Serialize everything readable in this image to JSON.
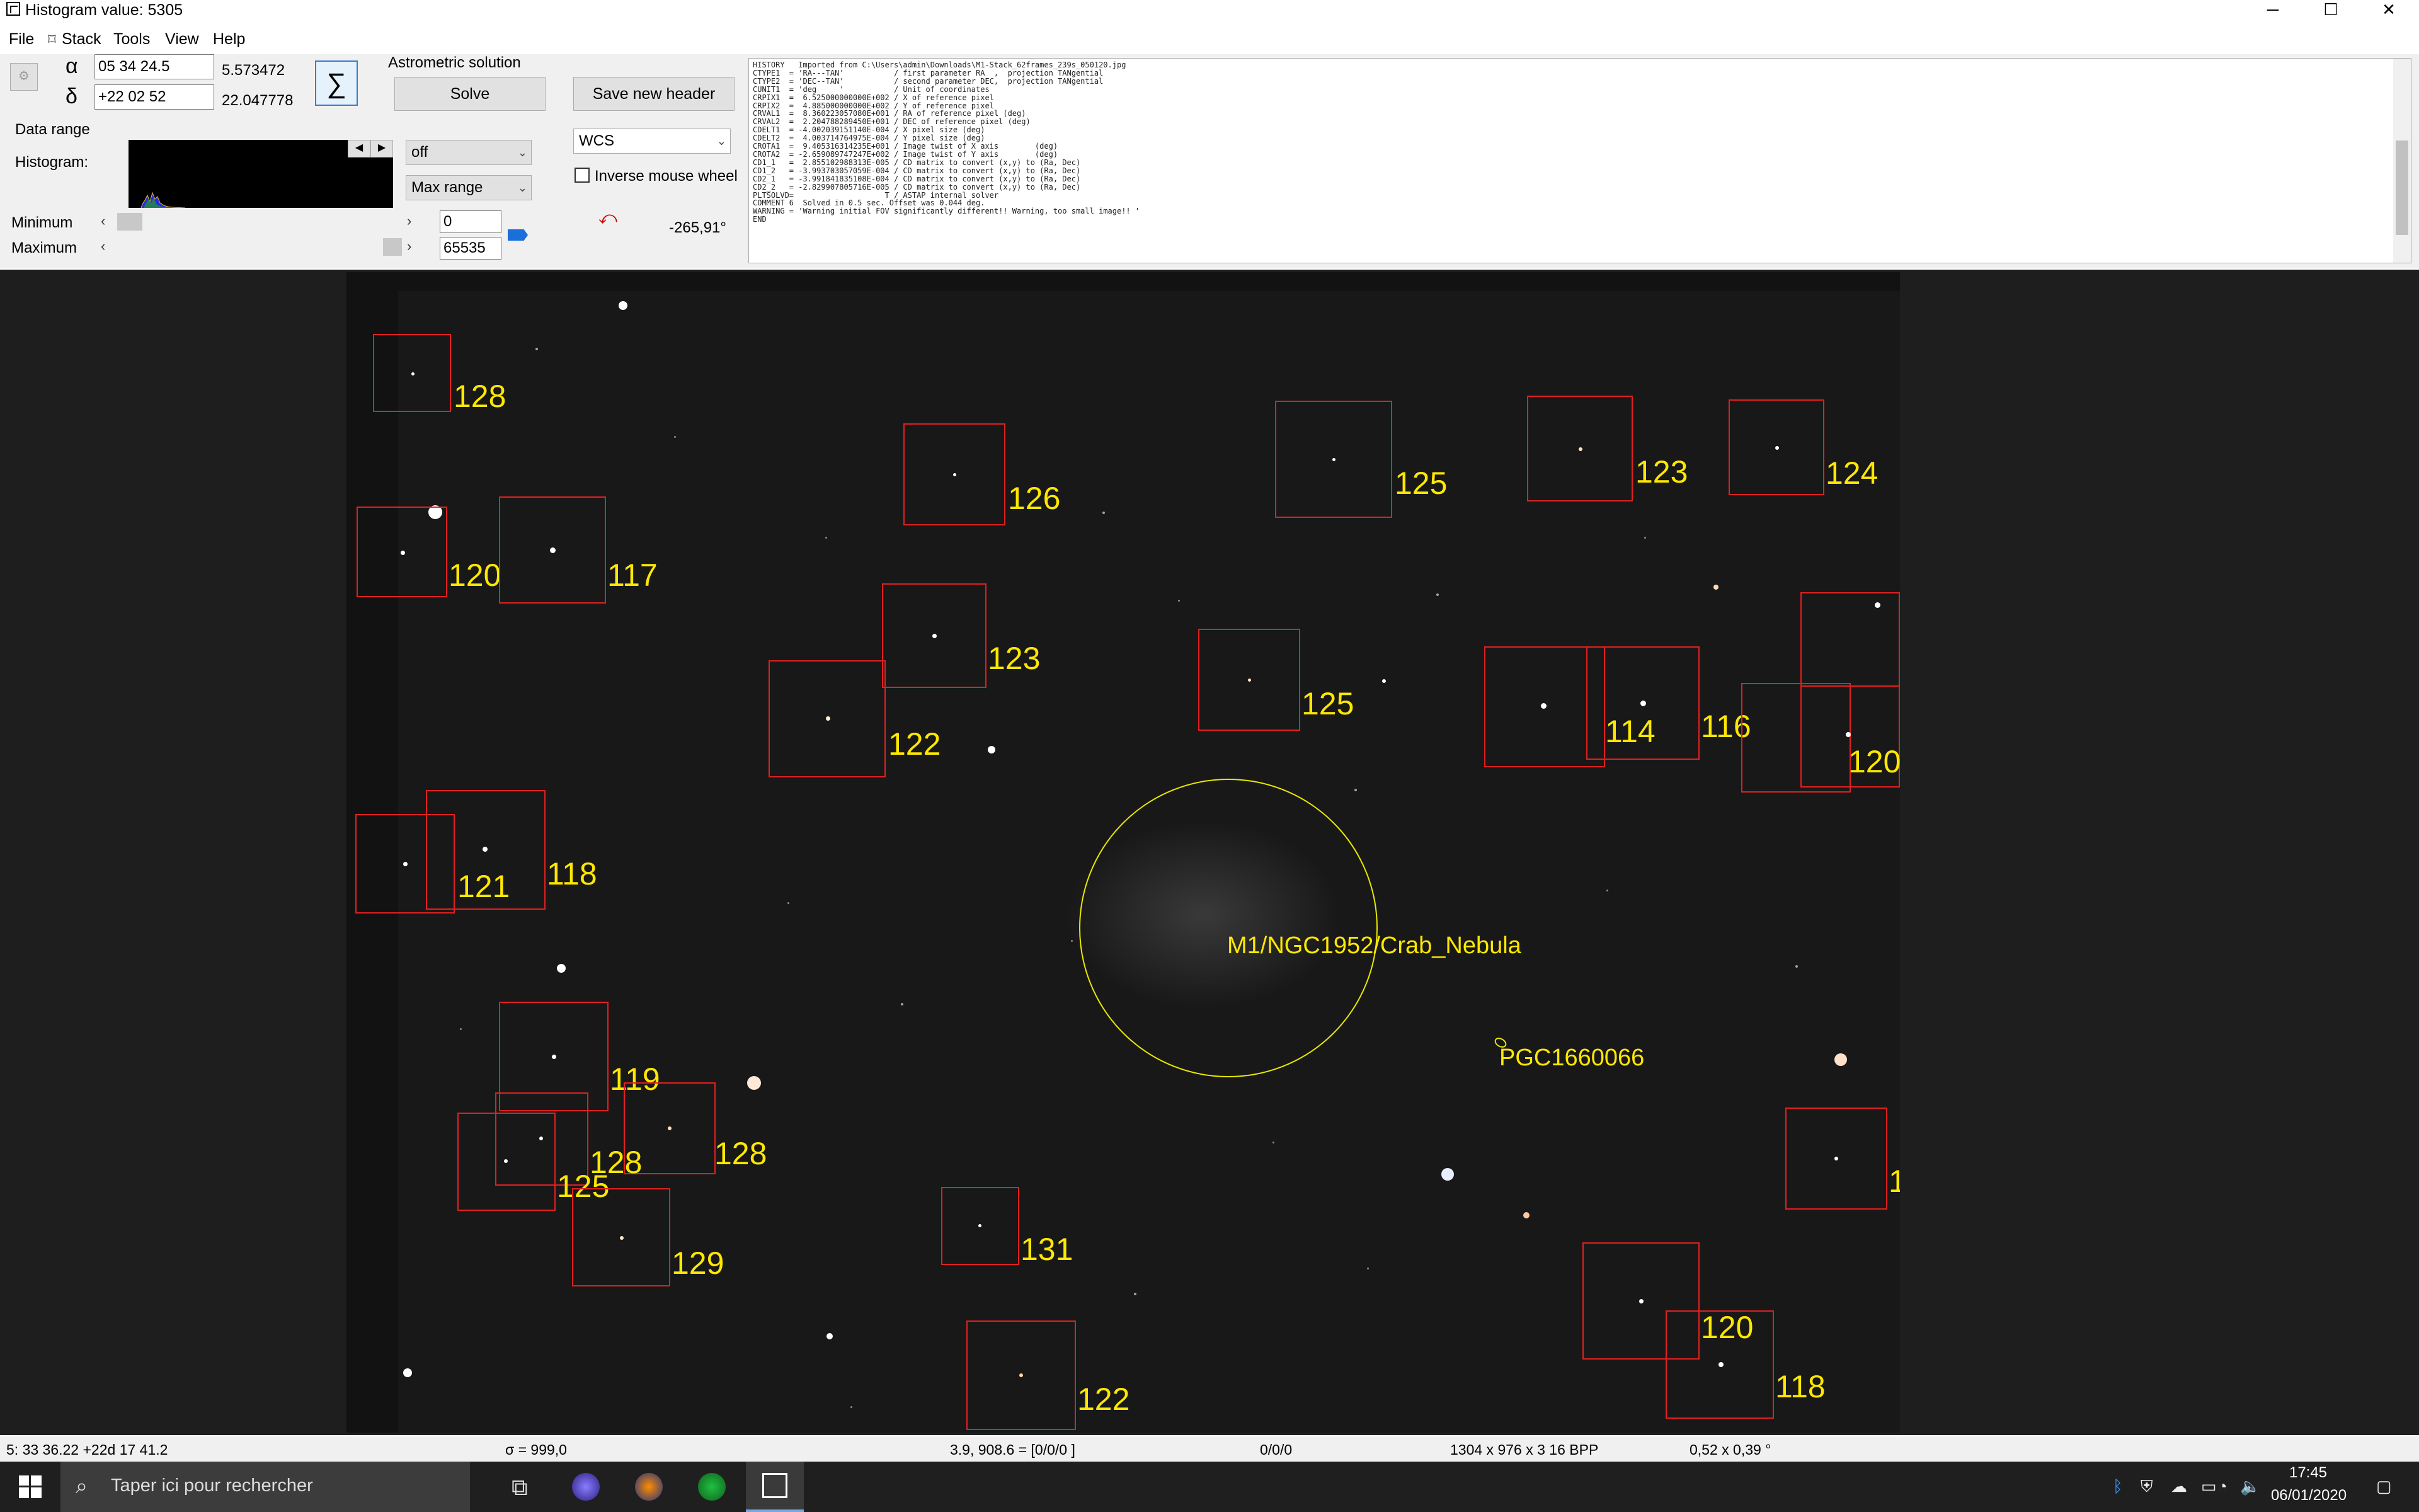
{
  "window": {
    "title": "Histogram value: 5305",
    "minimize": "─",
    "maximize": "☐",
    "close": "✕"
  },
  "menu": [
    "File",
    "Stack",
    "Tools",
    "View",
    "Help"
  ],
  "coords": {
    "alpha_symbol": "α",
    "delta_symbol": "δ",
    "ra_value": "05 34 24.5",
    "ra_decimal": "5.573472",
    "dec_value": "+22 02 52",
    "dec_decimal": "22.047778",
    "sigma_symbol": "∑"
  },
  "astrometric": {
    "label": "Astrometric solution",
    "solve_button": "Solve",
    "save_header_button": "Save new header",
    "wcs_selected": "WCS"
  },
  "data_range": {
    "label": "Data range",
    "histogram_label": "Histogram:",
    "mode_selected": "off",
    "range_selected": "Max range",
    "minimum_label": "Minimum",
    "maximum_label": "Maximum",
    "minimum_value": "0",
    "maximum_value": "65535",
    "inverse_mouse_wheel_label": "Inverse mouse wheel",
    "inverse_mouse_wheel_checked": false,
    "rotation_readout": "-265,91°"
  },
  "fits_header": "HISTORY   Imported from C:\\Users\\admin\\Downloads\\M1-Stack_62frames_239s_050120.jpg\nCTYPE1  = 'RA---TAN'           / first parameter RA  ,  projection TANgential\nCTYPE2  = 'DEC--TAN'           / second parameter DEC,  projection TANgential\nCUNIT1  = 'deg     '           / Unit of coordinates\nCRPIX1  =  6.525000000000E+002 / X of reference pixel\nCRPIX2  =  4.885000000000E+002 / Y of reference pixel\nCRVAL1  =  8.360223057080E+001 / RA of reference pixel (deg)\nCRVAL2  =  2.204788289450E+001 / DEC of reference pixel (deg)\nCDELT1  = -4.002039151140E-004 / X pixel size (deg)\nCDELT2  =  4.003714764975E-004 / Y pixel size (deg)\nCROTA1  =  9.405316314235E+001 / Image twist of X axis        (deg)\nCROTA2  = -2.659089747247E+002 / Image twist of Y axis        (deg)\nCD1_1   =  2.855102988313E-005 / CD matrix to convert (x,y) to (Ra, Dec)\nCD1_2   = -3.993703057059E-004 / CD matrix to convert (x,y) to (Ra, Dec)\nCD2_1   = -3.991841835108E-004 / CD matrix to convert (x,y) to (Ra, Dec)\nCD2_2   = -2.829907805716E-005 / CD matrix to convert (x,y) to (Ra, Dec)\nPLTSOLVD=                    T / ASTAP internal solver\nCOMMENT 6  Solved in 0.5 sec. Offset was 0.044 deg.\nWARNING = 'Warning initial FOV significantly different!! Warning, too small image!! '\nEND",
  "annotations": {
    "nebula": "M1/NGC1952/Crab_Nebula",
    "galaxy": "PGC1660066"
  },
  "star_labels": [
    {
      "hfd": "128"
    },
    {
      "hfd": "126"
    },
    {
      "hfd": "125"
    },
    {
      "hfd": "123"
    },
    {
      "hfd": "124"
    },
    {
      "hfd": "120"
    },
    {
      "hfd": "117"
    },
    {
      "hfd": "123"
    },
    {
      "hfd": "125"
    },
    {
      "hfd": "122"
    },
    {
      "hfd": "114"
    },
    {
      "hfd": "116"
    },
    {
      "hfd": "120"
    },
    {
      "hfd": "121"
    },
    {
      "hfd": "118"
    },
    {
      "hfd": "119"
    },
    {
      "hfd": "128"
    },
    {
      "hfd": "128"
    },
    {
      "hfd": "125"
    },
    {
      "hfd": "129"
    },
    {
      "hfd": "131"
    },
    {
      "hfd": "122"
    },
    {
      "hfd": "120"
    },
    {
      "hfd": "118"
    },
    {
      "hfd": "1"
    }
  ],
  "statusbar": {
    "cursor_coords": "5: 33  36.22  +22d 17  41.2",
    "sigma": "σ = 999,0",
    "pixel": "3.9, 908.6 = [0/0/0 ]",
    "rgb": "0/0/0",
    "dimensions": "1304 x 976 x 3   16 BPP",
    "fov": "0,52 x 0,39 °"
  },
  "taskbar": {
    "search_placeholder": "Taper ici pour rechercher",
    "time": "17:45",
    "date": "06/01/2020"
  }
}
